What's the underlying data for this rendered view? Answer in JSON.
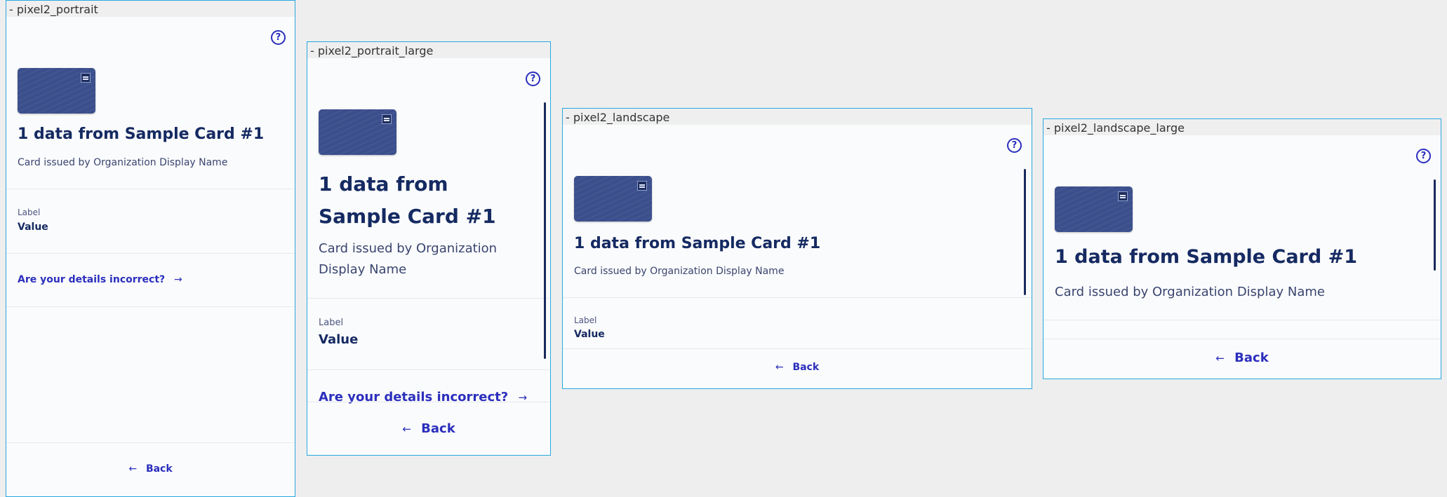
{
  "frames": [
    {
      "name": "- pixel2_portrait"
    },
    {
      "name": "- pixel2_portrait_large"
    },
    {
      "name": "- pixel2_landscape"
    },
    {
      "name": "- pixel2_landscape_large"
    }
  ],
  "screen": {
    "help_icon": "help-circle-icon",
    "title": "1 data from Sample Card #1",
    "subtitle": "Card issued by Organization Display Name",
    "attribute": {
      "label": "Label",
      "value": "Value"
    },
    "incorrect_link": "Are your details incorrect?",
    "back_label": "Back",
    "link_arrow": "→",
    "back_arrow": "←"
  },
  "colors": {
    "frame_border": "#28a8e0",
    "primary_text": "#152a62",
    "accent": "#2b2fbd",
    "card": "#3b4f8d"
  }
}
